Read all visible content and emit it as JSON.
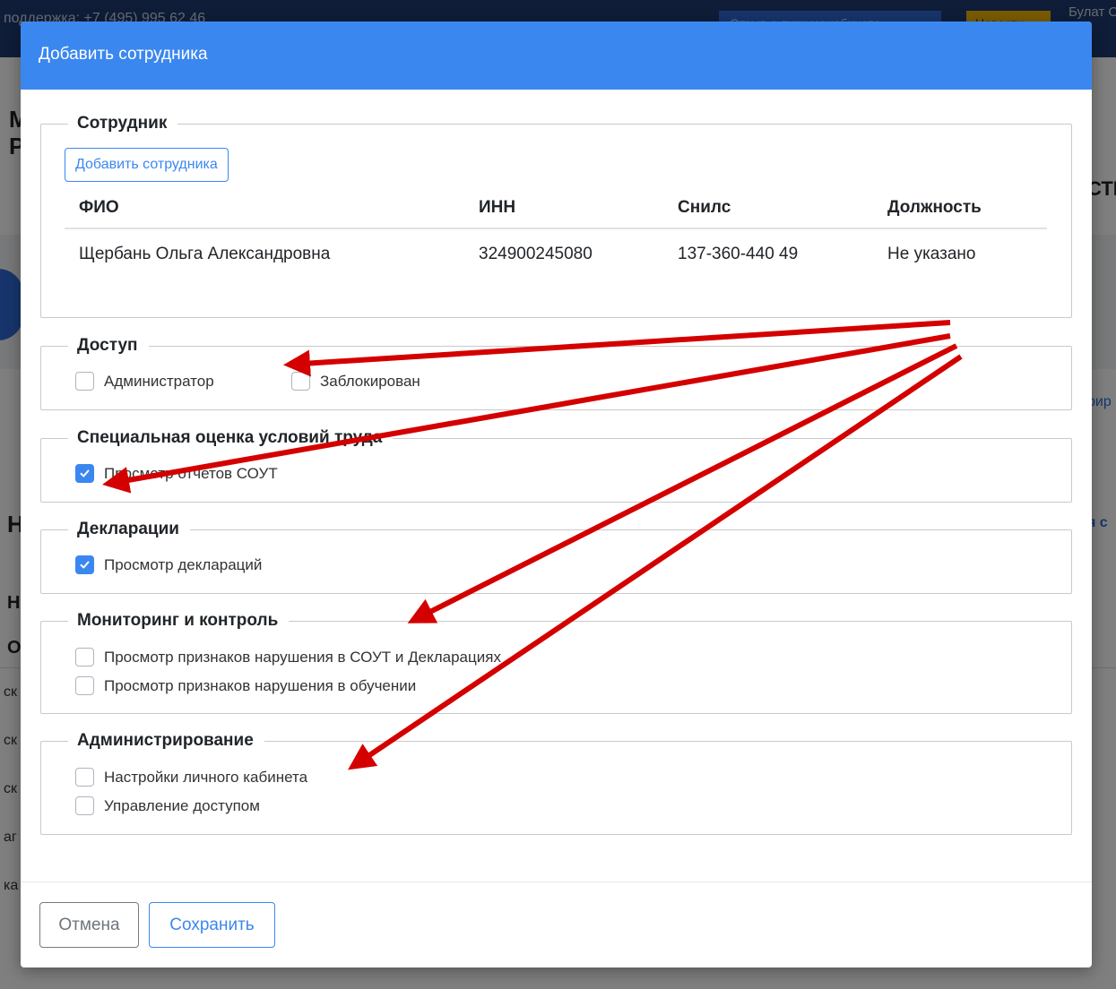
{
  "background": {
    "support_text": "поддержка: +7 (495) 995 62 46",
    "feedback_button": "Отзыв о личном кабинете",
    "news_button": "Новости",
    "user_text": "Булат ОО",
    "fragments": [
      "М",
      "Р",
      "Н",
      "Н",
      "О"
    ],
    "right_fragments": [
      "СТИ",
      "рир",
      "я с"
    ],
    "left_rows": [
      "ск",
      "ск",
      "ск",
      "аг",
      "ка"
    ]
  },
  "modal": {
    "title": "Добавить сотрудника",
    "employee_section": {
      "legend": "Сотрудник",
      "add_button": "Добавить сотрудника",
      "columns": [
        "ФИО",
        "ИНН",
        "Снилс",
        "Должность"
      ],
      "rows": [
        [
          "Щербань Ольга Александровна",
          "324900245080",
          "137-360-440 49",
          "Не указано"
        ]
      ]
    },
    "access_section": {
      "legend": "Доступ",
      "options": [
        {
          "label": "Администратор",
          "checked": false
        },
        {
          "label": "Заблокирован",
          "checked": false
        }
      ]
    },
    "sout_section": {
      "legend": "Специальная оценка условий труда",
      "options": [
        {
          "label": "Просмотр отчетов СОУТ",
          "checked": true
        }
      ]
    },
    "declarations_section": {
      "legend": "Декларации",
      "options": [
        {
          "label": "Просмотр деклараций",
          "checked": true
        }
      ]
    },
    "monitoring_section": {
      "legend": "Мониторинг и контроль",
      "options": [
        {
          "label": "Просмотр признаков нарушения в СОУТ и Декларациях",
          "checked": false
        },
        {
          "label": "Просмотр признаков нарушения в обучении",
          "checked": false
        }
      ]
    },
    "admin_section": {
      "legend": "Администрирование",
      "options": [
        {
          "label": "Настройки личного кабинета",
          "checked": false
        },
        {
          "label": "Управление доступом",
          "checked": false
        }
      ]
    },
    "cancel_button": "Отмена",
    "save_button": "Сохранить"
  },
  "colors": {
    "header": "#3b87f0",
    "accent": "#3b87f0",
    "annotation_arrow": "#d40000"
  }
}
